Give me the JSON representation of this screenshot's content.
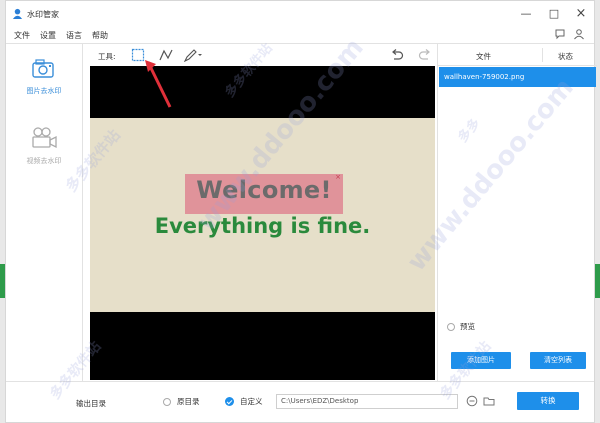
{
  "window": {
    "title": "水印管家",
    "controls": [
      "minimize",
      "maximize",
      "close"
    ]
  },
  "menu": {
    "items": [
      "文件",
      "设置",
      "语言",
      "帮助"
    ],
    "right_icons": [
      "chat-icon",
      "user-icon"
    ]
  },
  "sidebar": {
    "items": [
      {
        "label": "图片去水印",
        "icon": "image-icon",
        "active": true
      },
      {
        "label": "视频去水印",
        "icon": "video-camera-icon",
        "active": false
      }
    ]
  },
  "toolbar": {
    "label": "工具:",
    "tools": [
      "rectangle-select-icon",
      "polyline-icon",
      "brush-icon"
    ],
    "actions": [
      "undo-icon",
      "redo-icon"
    ]
  },
  "preview": {
    "image_text_line1": "Welcome!",
    "image_text_line2": "Everything is fine.",
    "selection_close": "×"
  },
  "file_panel": {
    "columns": [
      "文件",
      "状态"
    ],
    "files": [
      {
        "name": "wallhaven-759002.png",
        "status": ""
      }
    ],
    "preview_label": "预览",
    "add_button": "添加图片",
    "clear_button": "清空列表"
  },
  "output": {
    "label": "输出目录",
    "option_original": "原目录",
    "option_custom": "自定义",
    "selected": "自定义",
    "path": "C:\\Users\\EDZ\\Desktop",
    "convert_button": "转换"
  },
  "watermarks": {
    "site": "www.ddooo.com",
    "name": "多多软件站",
    "name_short": "多多"
  },
  "colors": {
    "accent": "#1e8fea",
    "image_bg": "#e6dfc9",
    "welcome_text": "#6b6b6b",
    "fine_text": "#2a8a3c",
    "selection": "#de7a8a",
    "annotation_arrow": "#e0303a"
  }
}
